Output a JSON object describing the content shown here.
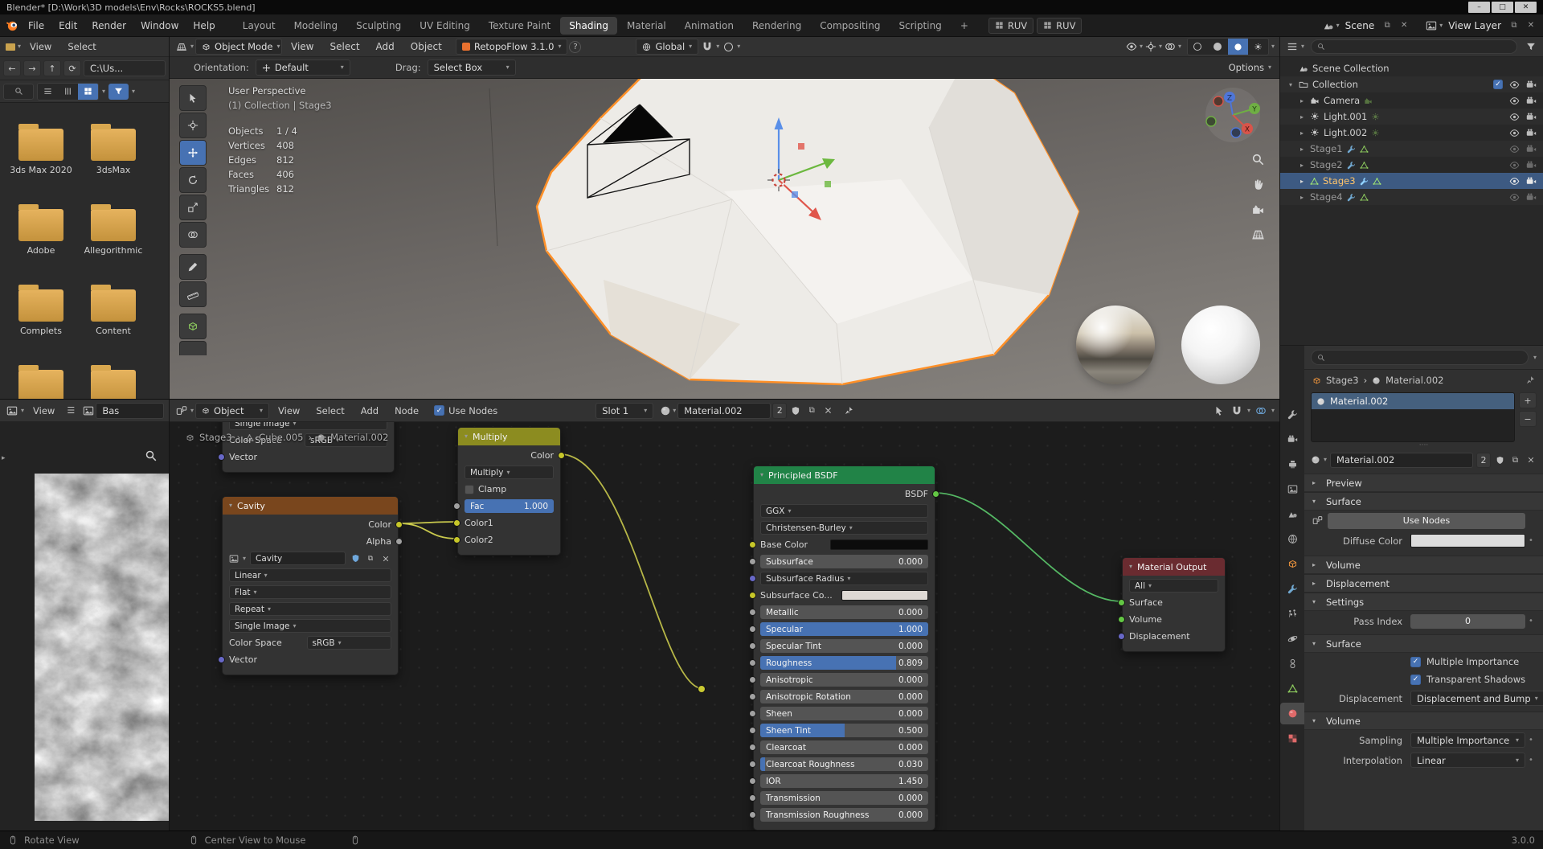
{
  "icons": {
    "caret": "▾",
    "tri_right": "▸",
    "tri_down": "▾",
    "close": "✕",
    "copy": "⧉",
    "plus": "+",
    "minus": "−",
    "check": "✓",
    "menu": "☰",
    "grip": "····",
    "dot": "•",
    "question": "?",
    "arrow_back": "←",
    "arrow_fwd": "→",
    "arrow_up": "↑",
    "refresh": "⟳",
    "chevron": "›",
    "minimize": "–",
    "maximize": "□"
  },
  "titlebar": {
    "title": "Blender* [D:\\Work\\3D models\\Env\\Rocks\\ROCKS5.blend]"
  },
  "menubar": {
    "menus": [
      "File",
      "Edit",
      "Render",
      "Window",
      "Help"
    ],
    "workspaces": [
      "Layout",
      "Modeling",
      "Sculpting",
      "UV Editing",
      "Texture Paint",
      "Shading",
      "Material",
      "Animation",
      "Rendering",
      "Compositing",
      "Scripting"
    ],
    "add_tab": "+",
    "ruv1": "RUV",
    "ruv2": "RUV",
    "scene_label": "Scene",
    "view_layer_label": "View Layer"
  },
  "viewport_header": {
    "mode": "Object Mode",
    "menus": [
      "View",
      "Select",
      "Add",
      "Object"
    ],
    "retopoflow": "RetopoFlow 3.1.0",
    "orientation": "Global"
  },
  "tool_settings": {
    "orientation_label": "Orientation:",
    "orientation_value": "Default",
    "drag_label": "Drag:",
    "drag_value": "Select Box",
    "options_label": "Options"
  },
  "file_browser": {
    "menu_view": "View",
    "menu_select": "Select",
    "path": "C:\\Us...",
    "folders": [
      "3ds Max 2020",
      "3dsMax",
      "Adobe",
      "Allegorithmic",
      "Complets",
      "Content"
    ]
  },
  "viewport": {
    "view_label": "User Perspective",
    "context_label": "(1) Collection | Stage3",
    "stats": [
      {
        "label": "Objects",
        "value": "1 / 4"
      },
      {
        "label": "Vertices",
        "value": "408"
      },
      {
        "label": "Edges",
        "value": "812"
      },
      {
        "label": "Faces",
        "value": "406"
      },
      {
        "label": "Triangles",
        "value": "812"
      }
    ],
    "axis": {
      "x": "X",
      "y": "Y",
      "z": "Z"
    }
  },
  "outliner": {
    "root": "Scene Collection",
    "items": [
      {
        "label": "Collection"
      },
      {
        "label": "Camera"
      },
      {
        "label": "Light.001"
      },
      {
        "label": "Light.002"
      },
      {
        "label": "Stage1"
      },
      {
        "label": "Stage2"
      },
      {
        "label": "Stage3"
      },
      {
        "label": "Stage4"
      }
    ]
  },
  "node_editor": {
    "object_selector": "Object",
    "menus": [
      "View",
      "Select",
      "Add",
      "Node"
    ],
    "use_nodes": "Use Nodes",
    "slot": "Slot 1",
    "material": "Material.002",
    "users": "2",
    "breadcrumb": {
      "object": "Stage3",
      "mesh": "Cube.005",
      "material": "Material.002"
    },
    "image_node_partial": {
      "source": "Single Image",
      "color_space_label": "Color Space",
      "color_space": "sRGB",
      "vector": "Vector"
    },
    "cavity_node": {
      "title": "Cavity",
      "out_color": "Color",
      "out_alpha": "Alpha",
      "image_name": "Cavity",
      "interpolation": "Linear",
      "projection": "Flat",
      "extension": "Repeat",
      "source": "Single Image",
      "color_space_label": "Color Space",
      "color_space": "sRGB",
      "vector": "Vector"
    },
    "multiply_node": {
      "title": "Multiply",
      "output": "Color",
      "blend_mode": "Multiply",
      "clamp": "Clamp",
      "fac_label": "Fac",
      "fac_value": "1.000",
      "fac_fill": 1,
      "inputs": [
        "Color1",
        "Color2"
      ]
    },
    "principled_node": {
      "title": "Principled BSDF",
      "output": "BSDF",
      "distribution": "GGX",
      "subsurface_method": "Christensen-Burley",
      "base_color_label": "Base Color",
      "subsurface_radius_label": "Subsurface Radius",
      "subsurface_color_label": "Subsurface Co...",
      "sliders": [
        {
          "label": "Subsurface",
          "value": "0.000",
          "fill": 0
        },
        {
          "label": "Metallic",
          "value": "0.000",
          "fill": 0
        },
        {
          "label": "Specular",
          "value": "1.000",
          "fill": 1
        },
        {
          "label": "Specular Tint",
          "value": "0.000",
          "fill": 0
        },
        {
          "label": "Roughness",
          "value": "0.809",
          "fill": 0.809
        },
        {
          "label": "Anisotropic",
          "value": "0.000",
          "fill": 0
        },
        {
          "label": "Anisotropic Rotation",
          "value": "0.000",
          "fill": 0
        },
        {
          "label": "Sheen",
          "value": "0.000",
          "fill": 0
        },
        {
          "label": "Sheen Tint",
          "value": "0.500",
          "fill": 0.5
        },
        {
          "label": "Clearcoat",
          "value": "0.000",
          "fill": 0
        },
        {
          "label": "Clearcoat Roughness",
          "value": "0.030",
          "fill": 0.03
        },
        {
          "label": "IOR",
          "value": "1.450",
          "fill": 0
        },
        {
          "label": "Transmission",
          "value": "0.000",
          "fill": 0
        },
        {
          "label": "Transmission Roughness",
          "value": "0.000",
          "fill": 0
        }
      ]
    },
    "output_node": {
      "title": "Material Output",
      "target": "All",
      "inputs": [
        "Surface",
        "Volume",
        "Displacement"
      ]
    }
  },
  "image_editor": {
    "menu_view": "View",
    "image_name": "Bas"
  },
  "properties": {
    "breadcrumb_object": "Stage3",
    "breadcrumb_material": "Material.002",
    "slot_item": "Material.002",
    "material_name": "Material.002",
    "users": "2",
    "preview_section": "Preview",
    "surface_section": "Surface",
    "use_nodes_button": "Use Nodes",
    "diffuse_color_label": "Diffuse Color",
    "volume_section": "Volume",
    "displacement_section": "Displacement",
    "settings_section": "Settings",
    "pass_index_label": "Pass Index",
    "pass_index_value": "0",
    "cycles_surface_section": "Surface",
    "multiple_importance": "Multiple Importance",
    "transparent_shadows": "Transparent Shadows",
    "displacement_label": "Displacement",
    "displacement_value": "Displacement and Bump",
    "cycles_volume_section": "Volume",
    "sampling_label": "Sampling",
    "sampling_value": "Multiple Importance",
    "interpolation_label": "Interpolation",
    "interpolation_value": "Linear"
  },
  "statusbar": {
    "left": "Rotate View",
    "middle": "Center View to Mouse",
    "version": "3.0.0"
  },
  "colors": {
    "accent": "#4772b3",
    "selection_outline": "#ff9028",
    "node_texture_header": "#79461d",
    "node_converter_header": "#8c8c20",
    "node_shader_header": "#218347",
    "node_output_header": "#6a2b30",
    "socket_color": "#c7c729",
    "socket_shader": "#63c744",
    "socket_vector": "#6868c7",
    "socket_value": "#a1a1a1"
  }
}
